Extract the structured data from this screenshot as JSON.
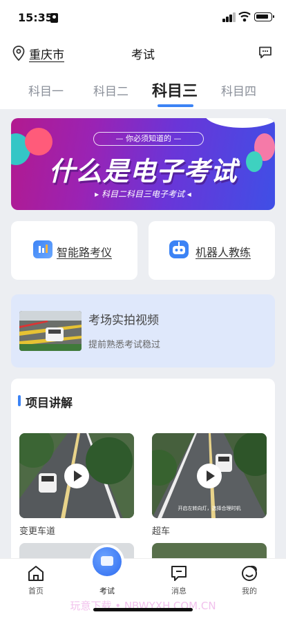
{
  "status": {
    "time": "15:35"
  },
  "header": {
    "city": "重庆市",
    "title": "考试"
  },
  "tabs": [
    {
      "label": "科目一",
      "active": false
    },
    {
      "label": "科目二",
      "active": false
    },
    {
      "label": "科目三",
      "active": true
    },
    {
      "label": "科目四",
      "active": false
    }
  ],
  "banner": {
    "pill": "— 你必须知道的 —",
    "title": "什么是电子考试",
    "subtitle": "▸ 科目二科目三电子考试 ◂"
  },
  "features": [
    {
      "label": "智能路考仪",
      "icon": "chart-bars-icon"
    },
    {
      "label": "机器人教练",
      "icon": "robot-icon"
    }
  ],
  "video_card": {
    "title": "考场实拍视频",
    "subtitle": "提前熟悉考试稳过"
  },
  "section": {
    "title": "项目讲解",
    "items": [
      {
        "label": "变更车道",
        "overlay": ""
      },
      {
        "label": "超车",
        "overlay": "开启左转向灯，选择合理时机"
      }
    ]
  },
  "nav": [
    {
      "label": "首页",
      "icon": "home-icon"
    },
    {
      "label": "考试",
      "icon": "exam-icon"
    },
    {
      "label": "消息",
      "icon": "message-icon"
    },
    {
      "label": "我的",
      "icon": "profile-icon"
    }
  ],
  "watermark": "玩意下载 • NBWYXH.COM.CN",
  "colors": {
    "accent": "#3c83f5",
    "card_bg": "#ffffff",
    "page_bg": "#eceef2",
    "video_card_bg": "#dfe8fb"
  }
}
